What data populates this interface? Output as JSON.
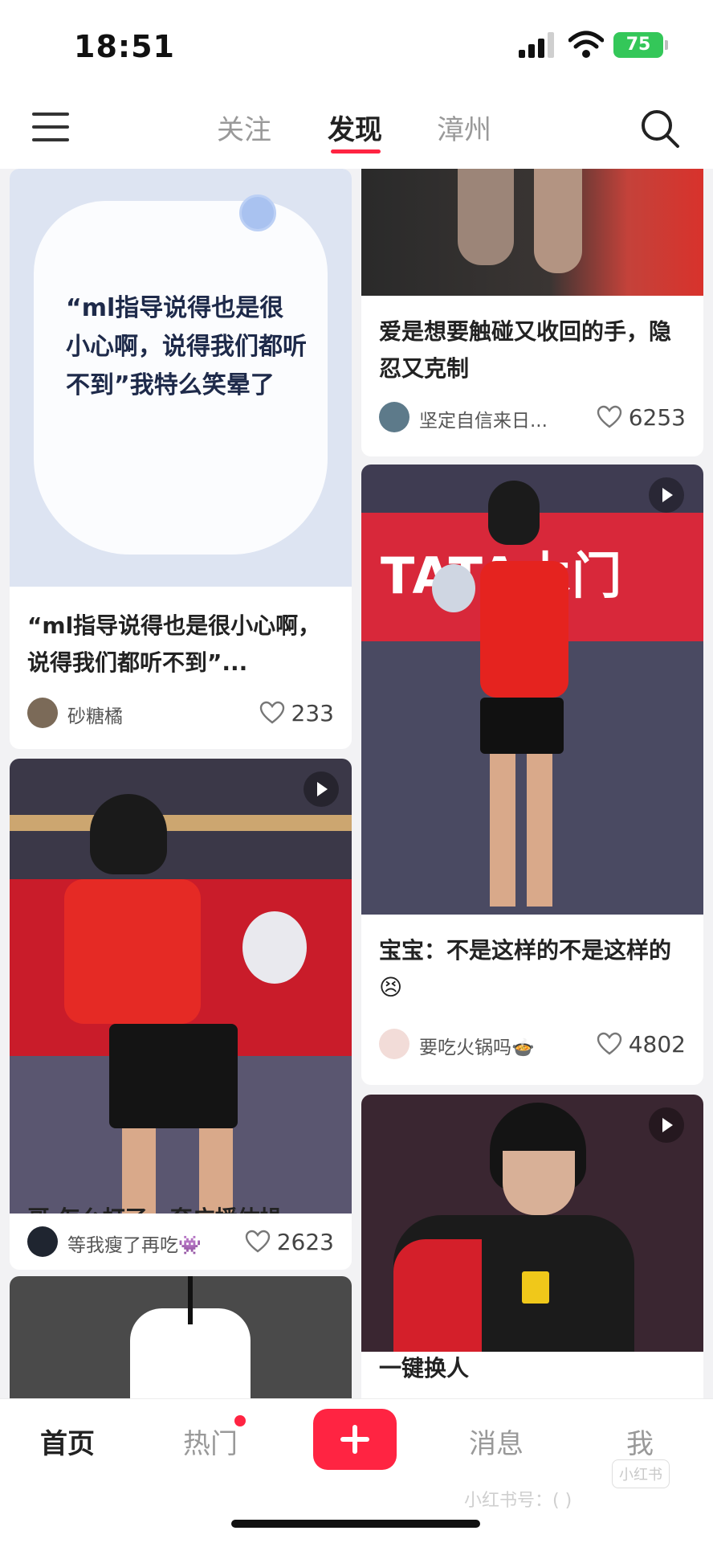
{
  "status_bar": {
    "time": "18:51",
    "battery": "75"
  },
  "top_nav": {
    "tabs": [
      {
        "label": "关注",
        "active": false
      },
      {
        "label": "发现",
        "active": true
      },
      {
        "label": "漳州",
        "active": false
      }
    ],
    "menu_icon": "hamburger-menu-icon",
    "search_icon": "search-icon",
    "accent_color": "#ff2442"
  },
  "feed": {
    "cards": [
      {
        "image_text": "“ml指导说得也是很小心啊，说得我们都听不到”我特么笑晕了",
        "title": "“ml指导说得也是很小心啊，说得我们都听不到”...",
        "author": "砂糖橘",
        "likes": "233",
        "video": false
      },
      {
        "title": "爱是想要触碰又收回的手，隐忍又克制",
        "author": "坚定自信来日...",
        "likes": "6253",
        "video": false
      },
      {
        "image_text": "TATA木门",
        "title": "宝宝：不是这样的不是这样的😣",
        "author": "要吃火锅吗🍲",
        "likes": "4802",
        "video": true
      },
      {
        "title": "哥 怎么打了一套广播体操",
        "author": "等我瘦了再吃👾",
        "likes": "2623",
        "video": true
      },
      {
        "title": "一键换人",
        "video": true
      }
    ]
  },
  "bottom_nav": {
    "items": [
      {
        "label": "首页",
        "active": true
      },
      {
        "label": "热门",
        "active": false,
        "badge": true
      },
      {
        "label": "消息",
        "active": false
      },
      {
        "label": "我",
        "active": false
      }
    ],
    "add_icon": "plus-icon",
    "watermark_logo": "小红书",
    "watermark": "小红书号：(     )"
  }
}
